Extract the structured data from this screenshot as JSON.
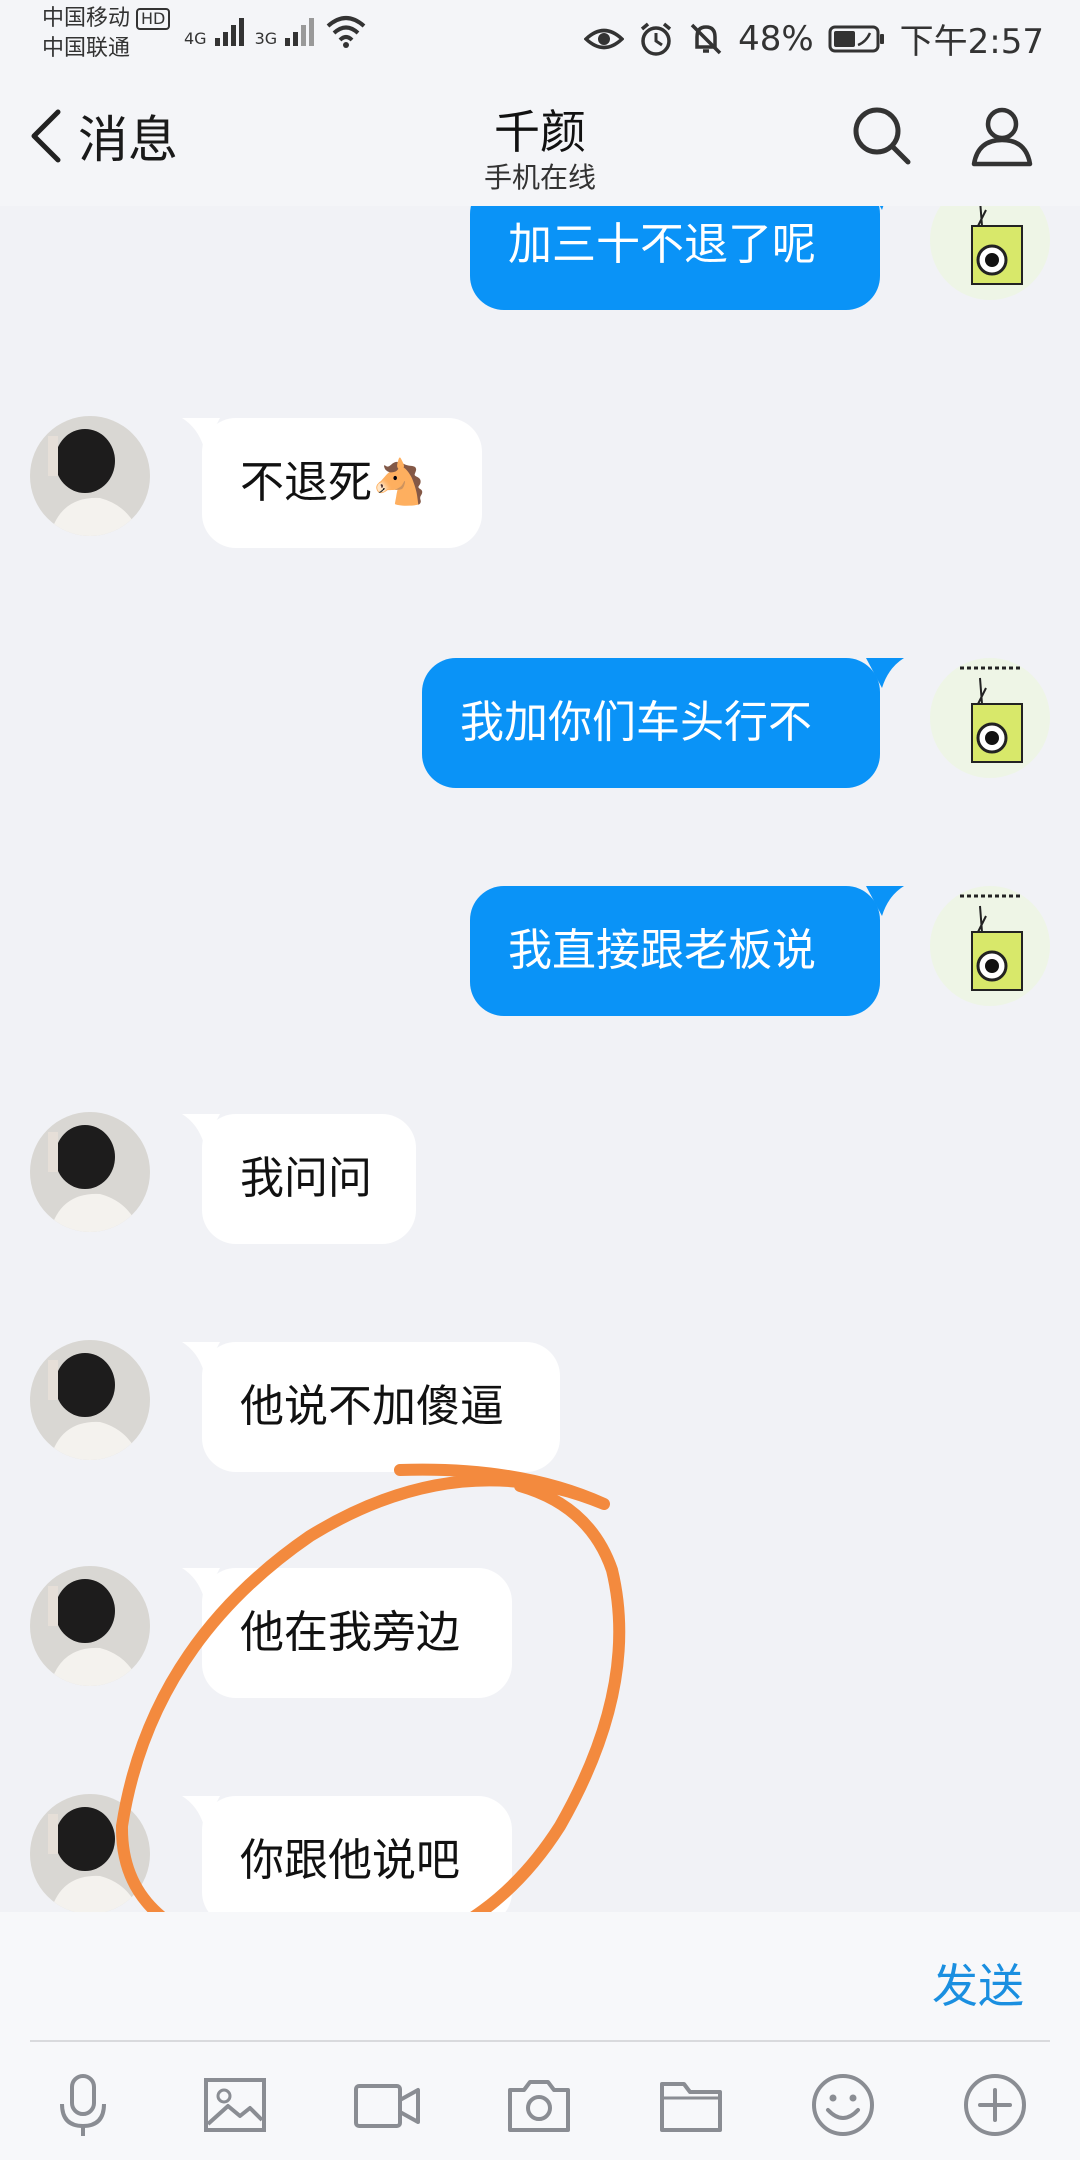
{
  "status_bar": {
    "carrier1": "中国移动",
    "hd_badge": "HD",
    "carrier2": "中国联通",
    "network1": "4G",
    "network2": "3G",
    "battery": "48%",
    "time": "下午2:57"
  },
  "header": {
    "back_label": "消息",
    "contact_name": "千颜",
    "contact_status": "手机在线"
  },
  "messages": [
    {
      "direction": "out",
      "text": "加三十不退了呢"
    },
    {
      "direction": "in",
      "text": "不退死🐴"
    },
    {
      "direction": "out",
      "text": "我加你们车头行不"
    },
    {
      "direction": "out",
      "text": "我直接跟老板说"
    },
    {
      "direction": "in",
      "text": "我问问"
    },
    {
      "direction": "in",
      "text": "他说不加傻逼"
    },
    {
      "direction": "in",
      "text": "他在我旁边"
    },
    {
      "direction": "in",
      "text": "你跟他说吧"
    }
  ],
  "input": {
    "send_label": "发送"
  },
  "colors": {
    "outgoing_bubble": "#0a93f7",
    "incoming_bubble": "#ffffff",
    "send_text": "#1a8fe0",
    "annotation": "#f38a3e",
    "background": "#f1f2f6"
  },
  "toolbar_icons": [
    "microphone-icon",
    "image-icon",
    "video-icon",
    "camera-icon",
    "folder-icon",
    "emoji-icon",
    "plus-icon"
  ]
}
